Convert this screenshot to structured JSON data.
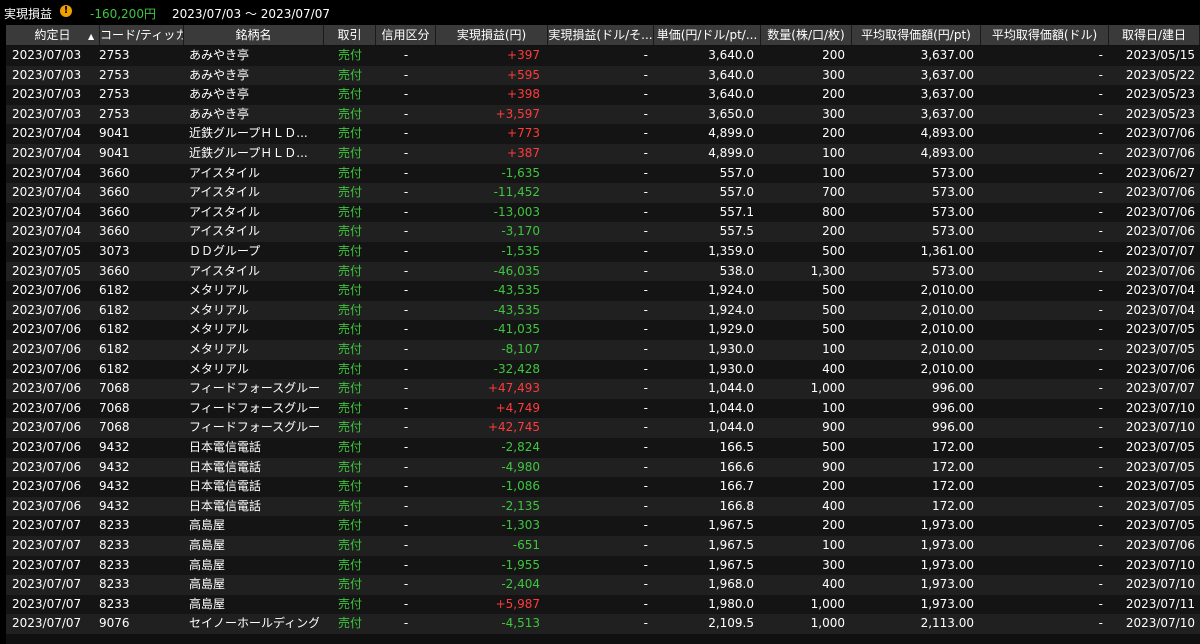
{
  "header": {
    "title": "実現損益",
    "warning_icon": "exclamation-icon",
    "total": "-160,200円",
    "period": "2023/07/03 ～ 2023/07/07"
  },
  "columns": [
    "約定日",
    "コード/ティッカー",
    "銘柄名",
    "取引",
    "信用区分",
    "実現損益(円)",
    "実現損益(ドル/そ...",
    "単価(円/ドル/pt/...",
    "数量(株/口/枚)",
    "平均取得価額(円/pt)",
    "平均取得価額(ドル)",
    "取得日/建日"
  ],
  "rows": [
    {
      "date": "2023/07/03",
      "code": "2753",
      "name": "あみやき亭",
      "side": "売付",
      "credit": "-",
      "pl": "+397",
      "pl_usd": "-",
      "price": "3,640.0",
      "qty": "200",
      "avg": "3,637.00",
      "avg_usd": "-",
      "acq": "2023/05/15"
    },
    {
      "date": "2023/07/03",
      "code": "2753",
      "name": "あみやき亭",
      "side": "売付",
      "credit": "-",
      "pl": "+595",
      "pl_usd": "-",
      "price": "3,640.0",
      "qty": "300",
      "avg": "3,637.00",
      "avg_usd": "-",
      "acq": "2023/05/22"
    },
    {
      "date": "2023/07/03",
      "code": "2753",
      "name": "あみやき亭",
      "side": "売付",
      "credit": "-",
      "pl": "+398",
      "pl_usd": "-",
      "price": "3,640.0",
      "qty": "200",
      "avg": "3,637.00",
      "avg_usd": "-",
      "acq": "2023/05/23"
    },
    {
      "date": "2023/07/03",
      "code": "2753",
      "name": "あみやき亭",
      "side": "売付",
      "credit": "-",
      "pl": "+3,597",
      "pl_usd": "-",
      "price": "3,650.0",
      "qty": "300",
      "avg": "3,637.00",
      "avg_usd": "-",
      "acq": "2023/05/23"
    },
    {
      "date": "2023/07/04",
      "code": "9041",
      "name": "近鉄グループＨＬＤ...",
      "side": "売付",
      "credit": "-",
      "pl": "+773",
      "pl_usd": "-",
      "price": "4,899.0",
      "qty": "200",
      "avg": "4,893.00",
      "avg_usd": "-",
      "acq": "2023/07/06"
    },
    {
      "date": "2023/07/04",
      "code": "9041",
      "name": "近鉄グループＨＬＤ...",
      "side": "売付",
      "credit": "-",
      "pl": "+387",
      "pl_usd": "-",
      "price": "4,899.0",
      "qty": "100",
      "avg": "4,893.00",
      "avg_usd": "-",
      "acq": "2023/07/06"
    },
    {
      "date": "2023/07/04",
      "code": "3660",
      "name": "アイスタイル",
      "side": "売付",
      "credit": "-",
      "pl": "-1,635",
      "pl_usd": "-",
      "price": "557.0",
      "qty": "100",
      "avg": "573.00",
      "avg_usd": "-",
      "acq": "2023/06/27"
    },
    {
      "date": "2023/07/04",
      "code": "3660",
      "name": "アイスタイル",
      "side": "売付",
      "credit": "-",
      "pl": "-11,452",
      "pl_usd": "-",
      "price": "557.0",
      "qty": "700",
      "avg": "573.00",
      "avg_usd": "-",
      "acq": "2023/07/06"
    },
    {
      "date": "2023/07/04",
      "code": "3660",
      "name": "アイスタイル",
      "side": "売付",
      "credit": "-",
      "pl": "-13,003",
      "pl_usd": "-",
      "price": "557.1",
      "qty": "800",
      "avg": "573.00",
      "avg_usd": "-",
      "acq": "2023/07/06"
    },
    {
      "date": "2023/07/04",
      "code": "3660",
      "name": "アイスタイル",
      "side": "売付",
      "credit": "-",
      "pl": "-3,170",
      "pl_usd": "-",
      "price": "557.5",
      "qty": "200",
      "avg": "573.00",
      "avg_usd": "-",
      "acq": "2023/07/06"
    },
    {
      "date": "2023/07/05",
      "code": "3073",
      "name": "ＤＤグループ",
      "side": "売付",
      "credit": "-",
      "pl": "-1,535",
      "pl_usd": "-",
      "price": "1,359.0",
      "qty": "500",
      "avg": "1,361.00",
      "avg_usd": "-",
      "acq": "2023/07/07"
    },
    {
      "date": "2023/07/05",
      "code": "3660",
      "name": "アイスタイル",
      "side": "売付",
      "credit": "-",
      "pl": "-46,035",
      "pl_usd": "-",
      "price": "538.0",
      "qty": "1,300",
      "avg": "573.00",
      "avg_usd": "-",
      "acq": "2023/07/06"
    },
    {
      "date": "2023/07/06",
      "code": "6182",
      "name": "メタリアル",
      "side": "売付",
      "credit": "-",
      "pl": "-43,535",
      "pl_usd": "-",
      "price": "1,924.0",
      "qty": "500",
      "avg": "2,010.00",
      "avg_usd": "-",
      "acq": "2023/07/04"
    },
    {
      "date": "2023/07/06",
      "code": "6182",
      "name": "メタリアル",
      "side": "売付",
      "credit": "-",
      "pl": "-43,535",
      "pl_usd": "-",
      "price": "1,924.0",
      "qty": "500",
      "avg": "2,010.00",
      "avg_usd": "-",
      "acq": "2023/07/04"
    },
    {
      "date": "2023/07/06",
      "code": "6182",
      "name": "メタリアル",
      "side": "売付",
      "credit": "-",
      "pl": "-41,035",
      "pl_usd": "-",
      "price": "1,929.0",
      "qty": "500",
      "avg": "2,010.00",
      "avg_usd": "-",
      "acq": "2023/07/05"
    },
    {
      "date": "2023/07/06",
      "code": "6182",
      "name": "メタリアル",
      "side": "売付",
      "credit": "-",
      "pl": "-8,107",
      "pl_usd": "-",
      "price": "1,930.0",
      "qty": "100",
      "avg": "2,010.00",
      "avg_usd": "-",
      "acq": "2023/07/05"
    },
    {
      "date": "2023/07/06",
      "code": "6182",
      "name": "メタリアル",
      "side": "売付",
      "credit": "-",
      "pl": "-32,428",
      "pl_usd": "-",
      "price": "1,930.0",
      "qty": "400",
      "avg": "2,010.00",
      "avg_usd": "-",
      "acq": "2023/07/06"
    },
    {
      "date": "2023/07/06",
      "code": "7068",
      "name": "フィードフォースグループ",
      "side": "売付",
      "credit": "-",
      "pl": "+47,493",
      "pl_usd": "-",
      "price": "1,044.0",
      "qty": "1,000",
      "avg": "996.00",
      "avg_usd": "-",
      "acq": "2023/07/07"
    },
    {
      "date": "2023/07/06",
      "code": "7068",
      "name": "フィードフォースグループ",
      "side": "売付",
      "credit": "-",
      "pl": "+4,749",
      "pl_usd": "-",
      "price": "1,044.0",
      "qty": "100",
      "avg": "996.00",
      "avg_usd": "-",
      "acq": "2023/07/10"
    },
    {
      "date": "2023/07/06",
      "code": "7068",
      "name": "フィードフォースグループ",
      "side": "売付",
      "credit": "-",
      "pl": "+42,745",
      "pl_usd": "-",
      "price": "1,044.0",
      "qty": "900",
      "avg": "996.00",
      "avg_usd": "-",
      "acq": "2023/07/10"
    },
    {
      "date": "2023/07/06",
      "code": "9432",
      "name": "日本電信電話",
      "side": "売付",
      "credit": "-",
      "pl": "-2,824",
      "pl_usd": "-",
      "price": "166.5",
      "qty": "500",
      "avg": "172.00",
      "avg_usd": "-",
      "acq": "2023/07/05"
    },
    {
      "date": "2023/07/06",
      "code": "9432",
      "name": "日本電信電話",
      "side": "売付",
      "credit": "-",
      "pl": "-4,980",
      "pl_usd": "-",
      "price": "166.6",
      "qty": "900",
      "avg": "172.00",
      "avg_usd": "-",
      "acq": "2023/07/05"
    },
    {
      "date": "2023/07/06",
      "code": "9432",
      "name": "日本電信電話",
      "side": "売付",
      "credit": "-",
      "pl": "-1,086",
      "pl_usd": "-",
      "price": "166.7",
      "qty": "200",
      "avg": "172.00",
      "avg_usd": "-",
      "acq": "2023/07/05"
    },
    {
      "date": "2023/07/06",
      "code": "9432",
      "name": "日本電信電話",
      "side": "売付",
      "credit": "-",
      "pl": "-2,135",
      "pl_usd": "-",
      "price": "166.8",
      "qty": "400",
      "avg": "172.00",
      "avg_usd": "-",
      "acq": "2023/07/05"
    },
    {
      "date": "2023/07/07",
      "code": "8233",
      "name": "高島屋",
      "side": "売付",
      "credit": "-",
      "pl": "-1,303",
      "pl_usd": "-",
      "price": "1,967.5",
      "qty": "200",
      "avg": "1,973.00",
      "avg_usd": "-",
      "acq": "2023/07/05"
    },
    {
      "date": "2023/07/07",
      "code": "8233",
      "name": "高島屋",
      "side": "売付",
      "credit": "-",
      "pl": "-651",
      "pl_usd": "-",
      "price": "1,967.5",
      "qty": "100",
      "avg": "1,973.00",
      "avg_usd": "-",
      "acq": "2023/07/06"
    },
    {
      "date": "2023/07/07",
      "code": "8233",
      "name": "高島屋",
      "side": "売付",
      "credit": "-",
      "pl": "-1,955",
      "pl_usd": "-",
      "price": "1,967.5",
      "qty": "300",
      "avg": "1,973.00",
      "avg_usd": "-",
      "acq": "2023/07/10"
    },
    {
      "date": "2023/07/07",
      "code": "8233",
      "name": "高島屋",
      "side": "売付",
      "credit": "-",
      "pl": "-2,404",
      "pl_usd": "-",
      "price": "1,968.0",
      "qty": "400",
      "avg": "1,973.00",
      "avg_usd": "-",
      "acq": "2023/07/10"
    },
    {
      "date": "2023/07/07",
      "code": "8233",
      "name": "高島屋",
      "side": "売付",
      "credit": "-",
      "pl": "+5,987",
      "pl_usd": "-",
      "price": "1,980.0",
      "qty": "1,000",
      "avg": "1,973.00",
      "avg_usd": "-",
      "acq": "2023/07/11"
    },
    {
      "date": "2023/07/07",
      "code": "9076",
      "name": "セイノーホールディングス",
      "side": "売付",
      "credit": "-",
      "pl": "-4,513",
      "pl_usd": "-",
      "price": "2,109.5",
      "qty": "1,000",
      "avg": "2,113.00",
      "avg_usd": "-",
      "acq": "2023/07/10"
    }
  ],
  "colors": {
    "positive": "#ff3b3b",
    "negative": "#3ec63e",
    "sell": "#3ec63e"
  }
}
